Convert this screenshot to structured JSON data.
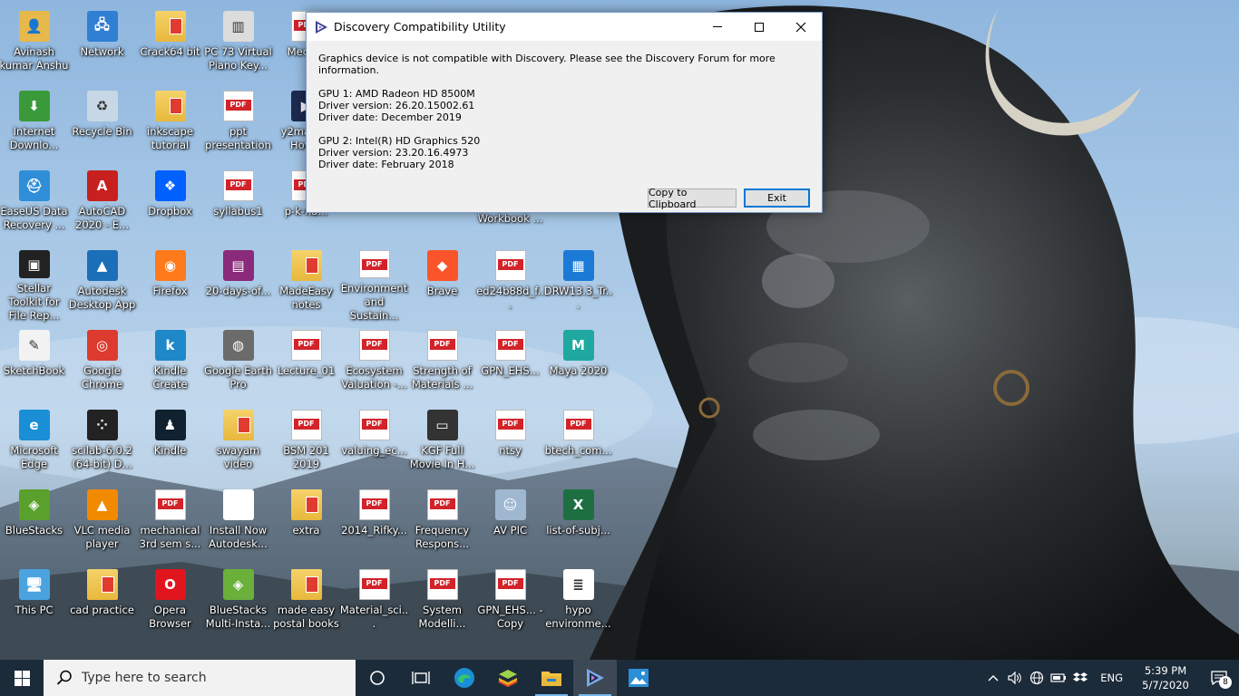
{
  "desktop": {
    "icons": [
      {
        "label": "Avinash kumar Anshu",
        "icon": "user-folder-icon",
        "color": "#e7b84a",
        "glyph": "👤"
      },
      {
        "label": "Network",
        "icon": "network-icon",
        "color": "#2f7fd3",
        "glyph": "🖧"
      },
      {
        "label": "Crack64 bit",
        "icon": "folder-icon",
        "color": "#e8b83c",
        "glyph": ""
      },
      {
        "label": "PC 73 Virtual Piano Key...",
        "icon": "piano-icon",
        "color": "#dcdcdc",
        "glyph": "▥"
      },
      {
        "label": "Mech...",
        "icon": "pdf-icon",
        "color": "#ffffff",
        "glyph": ""
      },
      {
        "label": "Internet Downlo...",
        "icon": "idm-icon",
        "color": "#3a9a3a",
        "glyph": "⬇"
      },
      {
        "label": "Recycle Bin",
        "icon": "recycle-bin-icon",
        "color": "#c8d7e6",
        "glyph": "♻"
      },
      {
        "label": "inkscape tutorial",
        "icon": "folder-icon",
        "color": "#e8b83c",
        "glyph": ""
      },
      {
        "label": "ppt presentation",
        "icon": "pdf-icon",
        "color": "#ffffff",
        "glyph": ""
      },
      {
        "label": "y2mat... - How...",
        "icon": "video-icon",
        "color": "#1d2a50",
        "glyph": "▶"
      },
      {
        "label": "EaseUS Data Recovery ...",
        "icon": "easeus-icon",
        "color": "#2e8fd8",
        "glyph": "⛑"
      },
      {
        "label": "AutoCAD 2020 - E...",
        "icon": "autocad-icon",
        "color": "#c8201e",
        "glyph": "A"
      },
      {
        "label": "Dropbox",
        "icon": "dropbox-icon",
        "color": "#0061fe",
        "glyph": "❖"
      },
      {
        "label": "syllabus1",
        "icon": "pdf-icon",
        "color": "#ffffff",
        "glyph": ""
      },
      {
        "label": "p-k-na...",
        "icon": "pdf-icon",
        "color": "#ffffff",
        "glyph": ""
      },
      {
        "label": "Stellar Toolkit for File Rep...",
        "icon": "stellar-icon",
        "color": "#222222",
        "glyph": "▣"
      },
      {
        "label": "Autodesk Desktop App",
        "icon": "autodesk-icon",
        "color": "#1b6fb8",
        "glyph": "▲"
      },
      {
        "label": "Firefox",
        "icon": "firefox-icon",
        "color": "#ff7a1a",
        "glyph": "◉"
      },
      {
        "label": "20-days-of...",
        "icon": "winrar-icon",
        "color": "#8a2a7a",
        "glyph": "▤"
      },
      {
        "label": "MadeEasy notes",
        "icon": "folder-icon",
        "color": "#e8b83c",
        "glyph": ""
      },
      {
        "label": "Environment and Sustain...",
        "icon": "pdf-icon",
        "color": "#ffffff",
        "glyph": ""
      },
      {
        "label": "Brave",
        "icon": "brave-icon",
        "color": "#fb542b",
        "glyph": "◆"
      },
      {
        "label": "ed24b88d_f...",
        "icon": "pdf-icon",
        "color": "#ffffff",
        "glyph": ""
      },
      {
        "label": "DRW13.3_Tr...",
        "icon": "drw-icon",
        "color": "#1a7ad6",
        "glyph": "▦"
      },
      {
        "label": "SketchBook",
        "icon": "sketchbook-icon",
        "color": "#f2f2f2",
        "glyph": "✎"
      },
      {
        "label": "Google Chrome",
        "icon": "chrome-icon",
        "color": "#dd3b2f",
        "glyph": "◎"
      },
      {
        "label": "Kindle Create",
        "icon": "kindle-create-icon",
        "color": "#1e88c8",
        "glyph": "k"
      },
      {
        "label": "Google Earth Pro",
        "icon": "google-earth-icon",
        "color": "#6b6b6b",
        "glyph": "◍"
      },
      {
        "label": "Lecture_01",
        "icon": "pdf-icon",
        "color": "#ffffff",
        "glyph": ""
      },
      {
        "label": "Ecosystem Valuation -...",
        "icon": "pdf-icon",
        "color": "#ffffff",
        "glyph": ""
      },
      {
        "label": "Strength of Materials ...",
        "icon": "pdf-icon",
        "color": "#ffffff",
        "glyph": ""
      },
      {
        "label": "GPN_EHS...",
        "icon": "pdf-icon",
        "color": "#ffffff",
        "glyph": ""
      },
      {
        "label": "Maya 2020",
        "icon": "maya-icon",
        "color": "#1fa8a0",
        "glyph": "M"
      },
      {
        "label": "Microsoft Edge",
        "icon": "edge-icon",
        "color": "#1a8fd6",
        "glyph": "e"
      },
      {
        "label": "scilab-6.0.2 (64-bit) D...",
        "icon": "scilab-icon",
        "color": "#222222",
        "glyph": "⁘"
      },
      {
        "label": "Kindle",
        "icon": "kindle-icon",
        "color": "#10212f",
        "glyph": "♟"
      },
      {
        "label": "swayam video",
        "icon": "folder-icon",
        "color": "#e8b83c",
        "glyph": ""
      },
      {
        "label": "BSM 201 2019",
        "icon": "pdf-icon",
        "color": "#ffffff",
        "glyph": ""
      },
      {
        "label": "valuing_ec...",
        "icon": "pdf-icon",
        "color": "#ffffff",
        "glyph": ""
      },
      {
        "label": "KGF Full Movie In H...",
        "icon": "video-file-icon",
        "color": "#333333",
        "glyph": "▭"
      },
      {
        "label": "ntsy",
        "icon": "pdf-icon",
        "color": "#ffffff",
        "glyph": ""
      },
      {
        "label": "btech_com...",
        "icon": "pdf-icon",
        "color": "#ffffff",
        "glyph": ""
      },
      {
        "label": "BlueStacks",
        "icon": "bluestacks-icon",
        "color": "#5aa02c",
        "glyph": "◈"
      },
      {
        "label": "VLC media player",
        "icon": "vlc-icon",
        "color": "#f28a00",
        "glyph": "▲"
      },
      {
        "label": "mechanical 3rd sem s...",
        "icon": "pdf-icon",
        "color": "#ffffff",
        "glyph": ""
      },
      {
        "label": "Install Now Autodesk...",
        "icon": "document-icon",
        "color": "#ffffff",
        "glyph": ""
      },
      {
        "label": "extra",
        "icon": "folder-icon",
        "color": "#e8b83c",
        "glyph": ""
      },
      {
        "label": "2014_Rifky...",
        "icon": "pdf-icon",
        "color": "#ffffff",
        "glyph": ""
      },
      {
        "label": "Frequency Respons...",
        "icon": "pdf-icon",
        "color": "#ffffff",
        "glyph": ""
      },
      {
        "label": "AV PIC",
        "icon": "photo-icon",
        "color": "#9fb8d0",
        "glyph": "☺"
      },
      {
        "label": "list-of-subj...",
        "icon": "excel-icon",
        "color": "#1d6f42",
        "glyph": "X"
      },
      {
        "label": "This PC",
        "icon": "this-pc-icon",
        "color": "#4aa3df",
        "glyph": "🖥"
      },
      {
        "label": "cad practice",
        "icon": "folder-icon",
        "color": "#e8b83c",
        "glyph": ""
      },
      {
        "label": "Opera Browser",
        "icon": "opera-icon",
        "color": "#e0151d",
        "glyph": "O"
      },
      {
        "label": "BlueStacks Multi-Insta...",
        "icon": "bluestacks-multi-icon",
        "color": "#6ab03a",
        "glyph": "◈"
      },
      {
        "label": "made easy postal books",
        "icon": "folder-icon",
        "color": "#e8b83c",
        "glyph": ""
      },
      {
        "label": "Material_sci...",
        "icon": "pdf-icon",
        "color": "#ffffff",
        "glyph": ""
      },
      {
        "label": "System Modelli...",
        "icon": "pdf-icon",
        "color": "#ffffff",
        "glyph": ""
      },
      {
        "label": "GPN_EHS... - Copy",
        "icon": "pdf-icon",
        "color": "#ffffff",
        "glyph": ""
      },
      {
        "label": "hypo environme...",
        "icon": "text-file-icon",
        "color": "#ffffff",
        "glyph": "≣"
      }
    ],
    "hidden_label": "Workbook ..."
  },
  "dialog": {
    "title": "Discovery Compatibility Utility",
    "message": "Graphics device is not compatible with Discovery. Please see the Discovery Forum for more information.",
    "gpu1_name": "GPU 1: AMD Radeon HD 8500M",
    "gpu1_version": "Driver version: 26.20.15002.61",
    "gpu1_date": "Driver date: December 2019",
    "gpu2_name": "GPU 2: Intel(R) HD Graphics 520",
    "gpu2_version": "Driver version: 23.20.16.4973",
    "gpu2_date": "Driver date: February 2018",
    "copy_label": "Copy to Clipboard",
    "exit_label": "Exit"
  },
  "taskbar": {
    "search_placeholder": "Type here to search",
    "language": "ENG",
    "time": "5:39 PM",
    "date": "5/7/2020",
    "notification_count": "8"
  }
}
